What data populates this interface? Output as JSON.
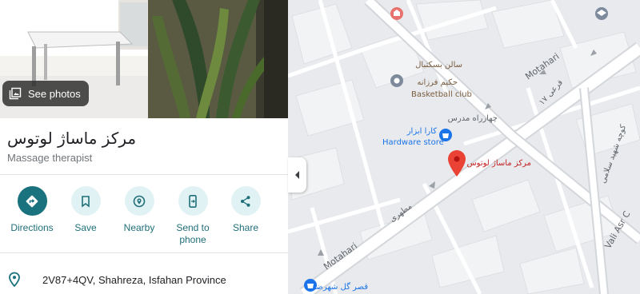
{
  "place": {
    "name": "مرکز ماساژ لوتوس",
    "category": "Massage therapist",
    "see_photos_label": "See photos",
    "address": "2V87+4QV, Shahreza, Isfahan Province"
  },
  "actions": [
    {
      "label": "Directions",
      "icon": "directions-icon"
    },
    {
      "label": "Save",
      "icon": "bookmark-icon"
    },
    {
      "label": "Nearby",
      "icon": "nearby-icon"
    },
    {
      "label": "Send to\nphone",
      "icon": "send-to-phone-icon"
    },
    {
      "label": "Share",
      "icon": "share-icon"
    }
  ],
  "map": {
    "roads": {
      "main_en_1": "Motahari",
      "main_en_2": "Motahari",
      "main_fa": "مطهری",
      "side_1": "فرعی ۱۷",
      "side_2": "کوچه شهید سلامی",
      "vali_asr": "Vali Asr C"
    },
    "pois": {
      "gym_line1": "سالن بسکتبال",
      "gym_line2": "حکیم فرزانه",
      "gym_en": "Basketball club",
      "crossroad": "چهارراه مدرس",
      "hardware_fa": "کارا ابزار",
      "hardware_en": "Hardware store",
      "selected_label": "مرکز ماساژ لوتوس",
      "bottom_store": "قصر گل شهرضا"
    },
    "colors": {
      "accent": "#1a727e",
      "poi_teal": "#1a73e8",
      "selected_red": "#ea4335",
      "poi_brown": "#7a5c3e"
    }
  }
}
